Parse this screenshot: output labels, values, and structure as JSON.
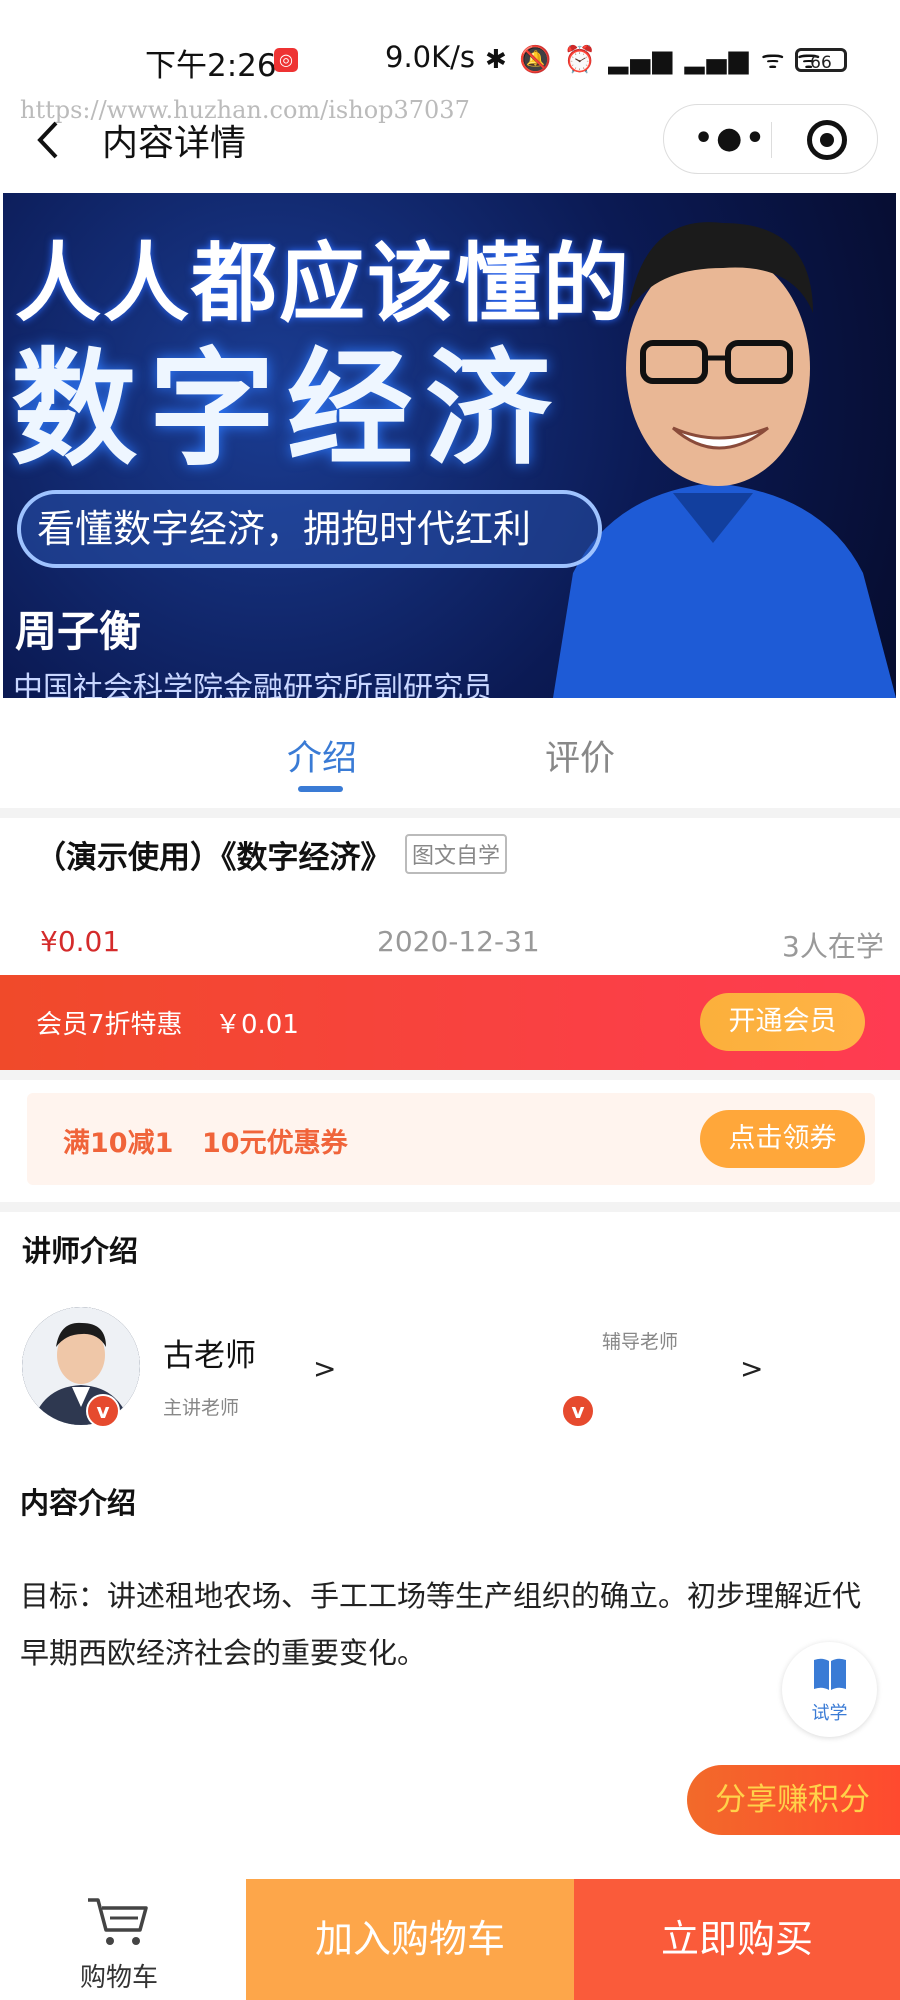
{
  "status": {
    "time": "下午2:26",
    "speed": "9.0K/s",
    "icons_text": "✱ 🔕 ⏰ ▂▄▆ ▂▄▆ ᯤ ᯤ",
    "battery": "66"
  },
  "watermark": "https://www.huzhan.com/ishop37037",
  "header": {
    "title": "内容详情"
  },
  "banner": {
    "line1": "人人都应该懂的",
    "line2": "数字经济",
    "tagline": "看懂数字经济，拥抱时代红利",
    "author": "周子衡",
    "org": "中国社会科学院金融研究所副研究员"
  },
  "tabs": [
    {
      "label": "介绍",
      "active": true
    },
    {
      "label": "评价",
      "active": false
    }
  ],
  "product": {
    "title": "（演示使用）《数字经济》",
    "tag": "图文自学",
    "price": "¥0.01",
    "date": "2020-12-31",
    "learners": "3人在学"
  },
  "member": {
    "text": "会员7折特惠",
    "price": "￥0.01",
    "button": "开通会员"
  },
  "coupon": {
    "rule": "满10减1",
    "name": "10元优惠券",
    "button": "点击领券"
  },
  "teachers": {
    "section_title": "讲师介绍",
    "main": {
      "name": "古老师",
      "role": "主讲老师",
      "arrow": ">"
    },
    "assistant": {
      "role": "辅导老师",
      "arrow": ">"
    },
    "badge": "v"
  },
  "content": {
    "section_title": "内容介绍",
    "text": "目标：讲述租地农场、手工工场等生产组织的确立。初步理解近代早期西欧经济社会的重要变化。"
  },
  "trial": {
    "label": "试学"
  },
  "share": {
    "label": "分享赚积分"
  },
  "bottom": {
    "cart": "购物车",
    "add_to_cart": "加入购物车",
    "buy_now": "立即购买"
  },
  "colors": {
    "accent_blue": "#3a7bd5",
    "price_red": "#d42b2b",
    "orange": "#fda64a",
    "buy_red": "#fa5b3a"
  }
}
